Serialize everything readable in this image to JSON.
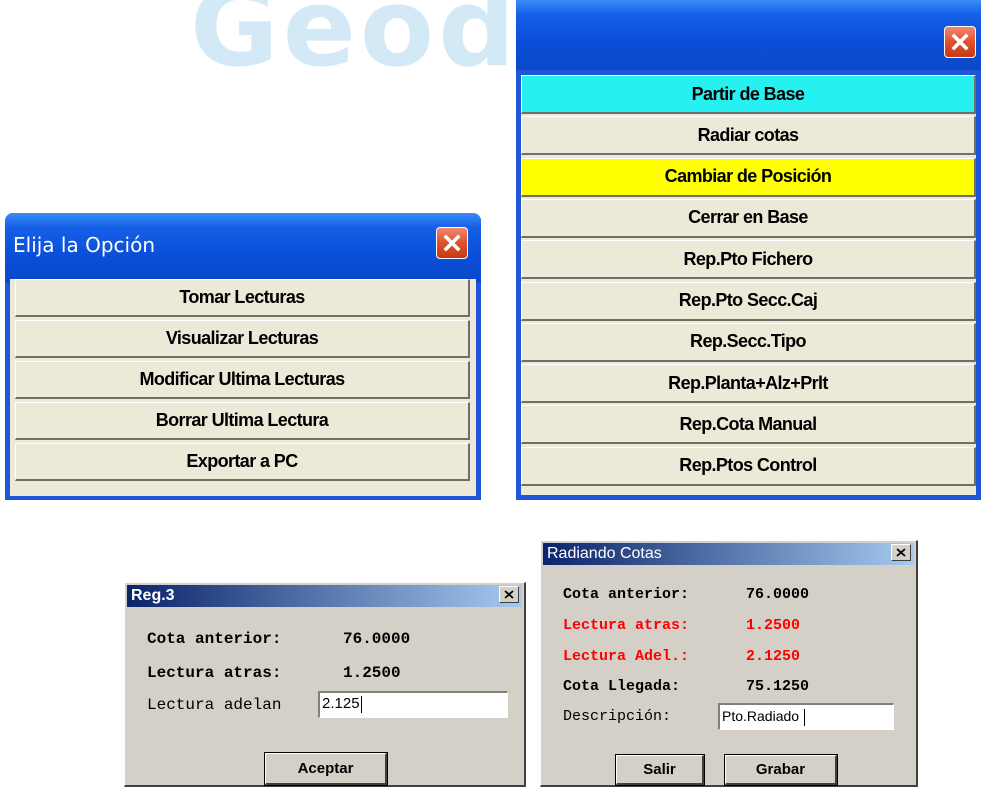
{
  "watermark": "Geodesical",
  "opcion_dialog": {
    "title": "Elija la  Opción",
    "buttons": [
      "Tomar Lecturas",
      "Visualizar Lecturas",
      "Modificar Ultima Lecturas",
      "Borrar Ultima Lectura",
      "Exportar a PC"
    ]
  },
  "base_menu": {
    "buttons": [
      {
        "label": "Partir de Base",
        "color": "#27f0f0"
      },
      {
        "label": "Radiar cotas",
        "color": "#ece9d8"
      },
      {
        "label": "Cambiar de Posición",
        "color": "#ffff00"
      },
      {
        "label": "Cerrar en Base",
        "color": "#ece9d8"
      },
      {
        "label": "Rep.Pto Fichero",
        "color": "#ece9d8"
      },
      {
        "label": "Rep.Pto Secc.Caj",
        "color": "#ece9d8"
      },
      {
        "label": "Rep.Secc.Tipo",
        "color": "#ece9d8"
      },
      {
        "label": "Rep.Planta+Alz+Prlt",
        "color": "#ece9d8"
      },
      {
        "label": "Rep.Cota Manual",
        "color": "#ece9d8"
      },
      {
        "label": "Rep.Ptos Control",
        "color": "#ece9d8"
      }
    ]
  },
  "reg_dialog": {
    "title": "Reg.3",
    "cota_anterior_label": "Cota anterior:",
    "cota_anterior_value": "76.0000",
    "lectura_atras_label": "Lectura atras:",
    "lectura_atras_value": "1.2500",
    "lectura_adelante_label": "Lectura adelan",
    "lectura_adelante_value": "2.125",
    "accept_label": "Aceptar"
  },
  "radiando_dialog": {
    "title": "Radiando Cotas",
    "cota_anterior_label": "Cota anterior:",
    "cota_anterior_value": "76.0000",
    "lectura_atras_label": "Lectura atras:",
    "lectura_atras_value": "1.2500",
    "lectura_adel_label": "Lectura Adel.:",
    "lectura_adel_value": "2.1250",
    "cota_llegada_label": "Cota Llegada:",
    "cota_llegada_value": "75.1250",
    "descripcion_label": "Descripción:",
    "descripcion_value": "Pto.Radiado",
    "salir_label": "Salir",
    "grabar_label": "Grabar"
  },
  "colors": {
    "highlight_red": "#ff0000",
    "xp_title_blue": "#0a4fd8",
    "classic_title_blue": "#0a246a"
  }
}
